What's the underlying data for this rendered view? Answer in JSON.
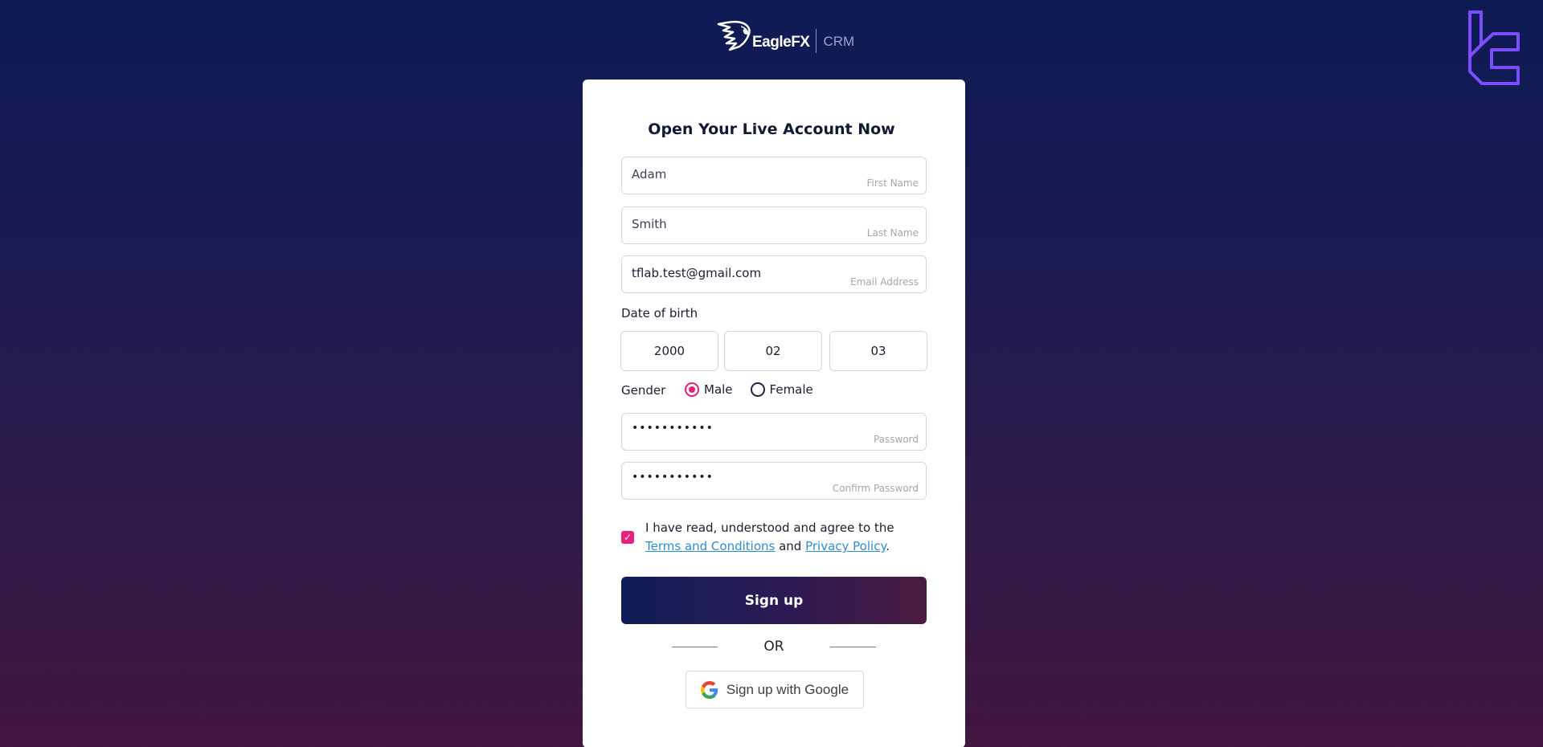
{
  "header": {
    "brand_name": "EagleFX",
    "brand_suffix": "CRM",
    "corner_logo": "tradingfinder-logo-icon"
  },
  "form": {
    "title": "Open Your Live Account Now",
    "first_name": {
      "value": "Adam",
      "label": "First Name"
    },
    "last_name": {
      "value": "Smith",
      "label": "Last Name"
    },
    "email": {
      "value": "tflab.test@gmail.com",
      "label": "Email Address"
    },
    "dob": {
      "label": "Date of birth",
      "year": "2000",
      "month": "02",
      "day": "03"
    },
    "gender": {
      "label": "Gender",
      "options": [
        {
          "label": "Male",
          "selected": true
        },
        {
          "label": "Female",
          "selected": false
        }
      ]
    },
    "password": {
      "value": "•••••••••••",
      "label": "Password"
    },
    "confirm_password": {
      "value": "•••••••••••",
      "label": "Confirm Password"
    },
    "terms": {
      "checked": true,
      "checkmark": "✓",
      "prefix": "I have read, understood and agree to the ",
      "terms_link": "Terms and Conditions",
      "middle": " and ",
      "privacy_link": "Privacy Policy",
      "suffix": "."
    },
    "signup_label": "Sign up",
    "or_label": "OR",
    "google_label": "Sign up with Google"
  },
  "colors": {
    "accent_pink": "#e81e78",
    "link_blue": "#2a8fd6",
    "button_gradient_start": "#0f1d57",
    "button_gradient_end": "#4a1a40",
    "brand_mark_purple": "#7b4dff"
  }
}
